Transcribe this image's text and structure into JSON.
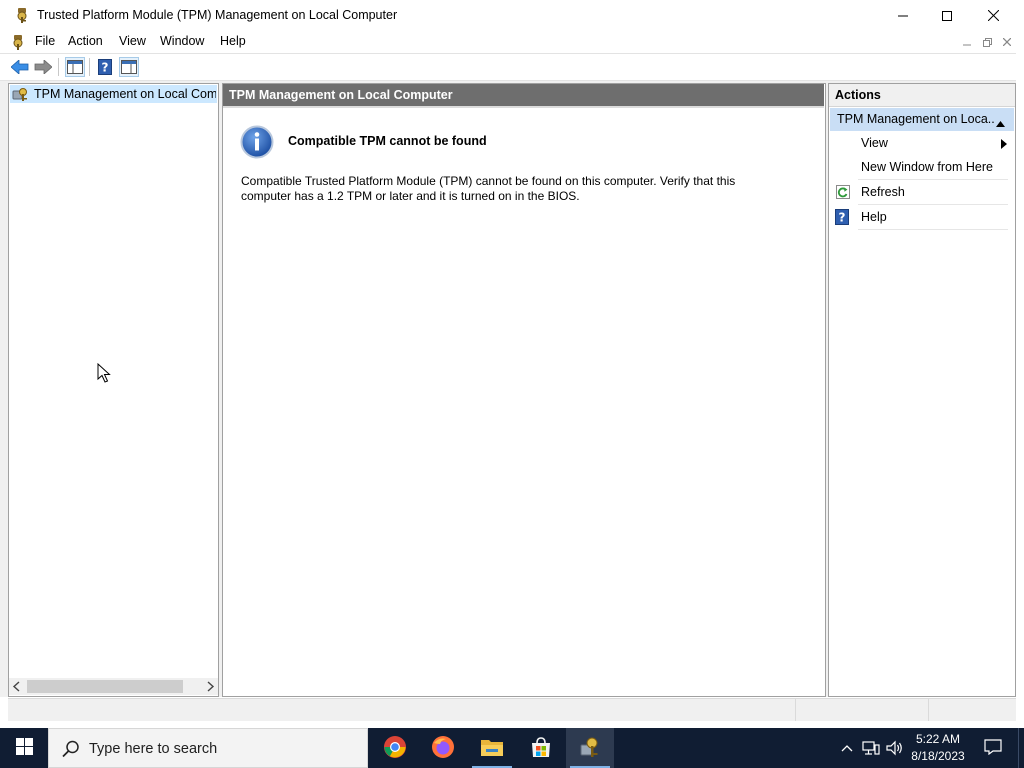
{
  "window": {
    "title": "Trusted Platform Module (TPM) Management on Local Computer",
    "app_icon": "tpm-key-icon"
  },
  "menubar": {
    "items": [
      {
        "label": "File"
      },
      {
        "label": "Action"
      },
      {
        "label": "View"
      },
      {
        "label": "Window"
      },
      {
        "label": "Help"
      }
    ]
  },
  "toolbar": {
    "buttons": [
      "back-arrow-icon",
      "forward-arrow-icon",
      "show-hide-console-tree-icon",
      "help-icon",
      "show-hide-action-pane-icon"
    ]
  },
  "tree": {
    "items": [
      {
        "label": "TPM Management on Local Computer",
        "icon": "tpm-key-icon",
        "selected": true
      }
    ]
  },
  "center": {
    "header": "TPM Management on Local Computer",
    "message_heading": "Compatible TPM cannot be found",
    "message_body": "Compatible Trusted Platform Module (TPM) cannot be found on this computer. Verify that this computer has a 1.2 TPM or later and it is turned on in the BIOS.",
    "message_icon": "info-icon"
  },
  "actions": {
    "title": "Actions",
    "section": "TPM Management on Loca...",
    "items": [
      {
        "label": "View",
        "has_submenu": true
      },
      {
        "label": "New Window from Here"
      },
      {
        "label": "Refresh",
        "icon": "refresh-icon"
      },
      {
        "label": "Help",
        "icon": "help-icon"
      }
    ]
  },
  "taskbar": {
    "search_placeholder": "Type here to search",
    "apps": [
      "chrome-icon",
      "firefox-icon",
      "file-explorer-icon",
      "microsoft-store-icon",
      "tpm-key-icon"
    ],
    "active_app": "tpm-key-icon",
    "clock_time": "5:22 AM",
    "clock_date": "8/18/2023"
  },
  "colors": {
    "center_header_bg": "#6e6e6e",
    "actions_section_bg": "#c9def5",
    "tree_selection_bg": "#cce8ff",
    "taskbar_bg": "#101d33"
  }
}
